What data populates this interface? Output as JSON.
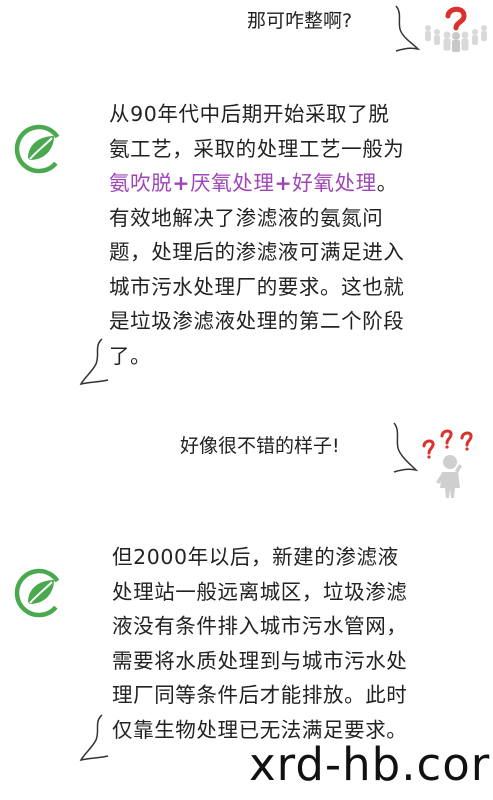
{
  "messages": [
    {
      "text": "那可咋整啊?"
    },
    {
      "lines": [
        "从90年代中后期开始采取了脱",
        "氨工艺，采取的处理工艺一般为"
      ],
      "highlight_line": [
        "氨吹脱",
        "+",
        "厌氧处理",
        "+",
        "好氧处理",
        "。"
      ],
      "lines2": [
        "有效地解决了渗滤液的氨氮问",
        "题，处理后的渗滤液可满足进入",
        "城市污水处理厂的要求。这也就",
        "是垃圾渗滤液处理的第二个阶段",
        "了。"
      ]
    },
    {
      "text": "好像很不错的样子!"
    },
    {
      "lines": [
        "但2000年以后，新建的渗滤液",
        "处理站一般远离城区，垃圾渗滤",
        "液没有条件排入城市污水管网，",
        "需要将水质处理到与城市污水处",
        "理厂同等条件后才能排放。此时",
        "仅靠生物处理已无法满足要求。"
      ]
    }
  ],
  "watermark": "xrd-hb.cor",
  "colors": {
    "highlight": "#a045b8",
    "leaf_green": "#4aa84f",
    "question_red": "#d8322b"
  },
  "icons": [
    "leaf-logo-icon",
    "question-crowd-icon",
    "question-person-icon"
  ]
}
